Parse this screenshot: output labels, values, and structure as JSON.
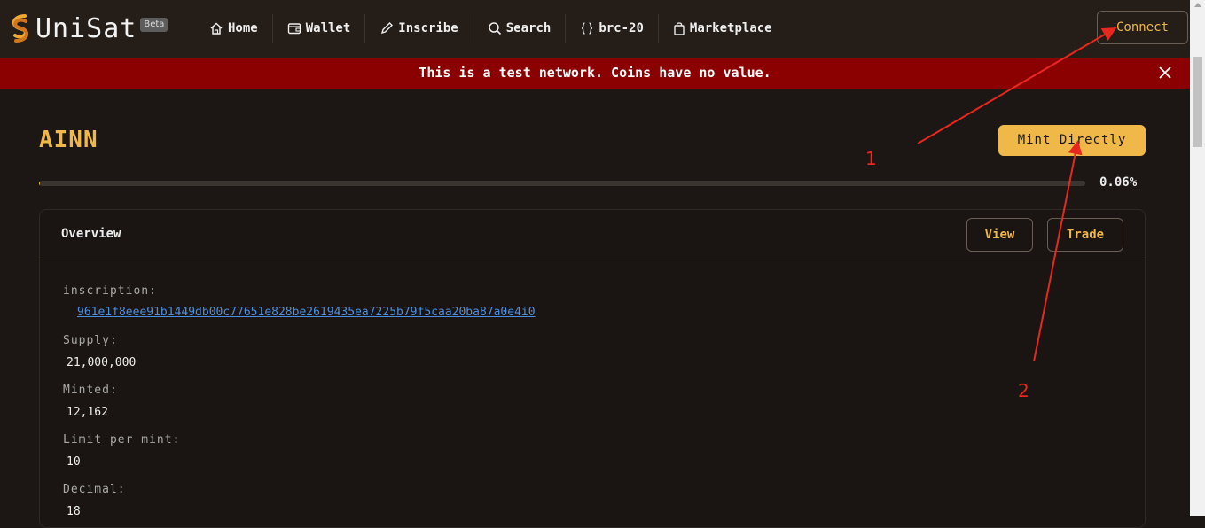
{
  "brand": {
    "name": "UniSat",
    "badge": "Beta"
  },
  "nav": [
    {
      "label": "Home",
      "icon": "home-icon"
    },
    {
      "label": "Wallet",
      "icon": "wallet-icon"
    },
    {
      "label": "Inscribe",
      "icon": "pencil-icon"
    },
    {
      "label": "Search",
      "icon": "search-icon"
    },
    {
      "label": "brc-20",
      "icon": "braces-icon"
    },
    {
      "label": "Marketplace",
      "icon": "bag-icon"
    }
  ],
  "connect_label": "Connect",
  "banner": {
    "text": "This is a test network. Coins have no value."
  },
  "token": {
    "name": "AINN",
    "mint_label": "Mint Directly",
    "progress_percent": 0.06,
    "progress_text": "0.06%"
  },
  "overview": {
    "title": "Overview",
    "view_label": "View",
    "trade_label": "Trade",
    "fields": {
      "inscription_label": "inscription:",
      "inscription_value": "961e1f8eee91b1449db00c77651e828be2619435ea7225b79f5caa20ba87a0e4i0",
      "supply_label": "Supply:",
      "supply_value": "21,000,000",
      "minted_label": "Minted:",
      "minted_value": "12,162",
      "limit_label": "Limit per mint:",
      "limit_value": "10",
      "decimal_label": "Decimal:",
      "decimal_value": "18"
    }
  },
  "annotations": {
    "one": "1",
    "two": "2"
  },
  "colors": {
    "accent": "#f0b848",
    "banner": "#8b0000",
    "annotation": "#e8281e",
    "link": "#4a90e2"
  }
}
